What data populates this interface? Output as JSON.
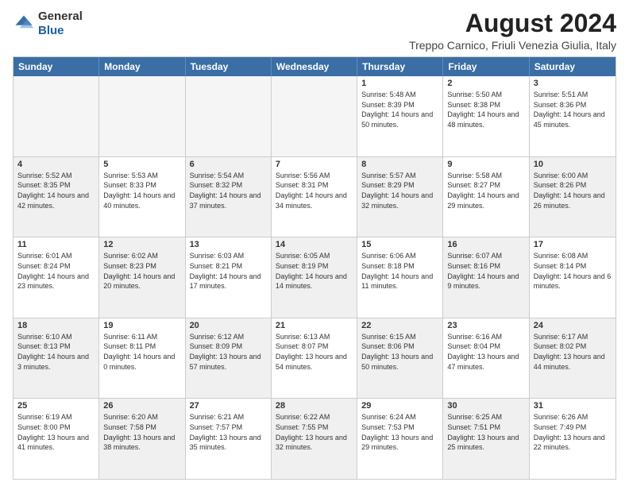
{
  "logo": {
    "general": "General",
    "blue": "Blue"
  },
  "header": {
    "month_year": "August 2024",
    "location": "Treppo Carnico, Friuli Venezia Giulia, Italy"
  },
  "days_of_week": [
    "Sunday",
    "Monday",
    "Tuesday",
    "Wednesday",
    "Thursday",
    "Friday",
    "Saturday"
  ],
  "rows": [
    {
      "cells": [
        {
          "day": "",
          "empty": true
        },
        {
          "day": "",
          "empty": true
        },
        {
          "day": "",
          "empty": true
        },
        {
          "day": "",
          "empty": true
        },
        {
          "day": "1",
          "info": "Sunrise: 5:48 AM\nSunset: 8:39 PM\nDaylight: 14 hours and 50 minutes."
        },
        {
          "day": "2",
          "info": "Sunrise: 5:50 AM\nSunset: 8:38 PM\nDaylight: 14 hours and 48 minutes."
        },
        {
          "day": "3",
          "info": "Sunrise: 5:51 AM\nSunset: 8:36 PM\nDaylight: 14 hours and 45 minutes."
        }
      ]
    },
    {
      "cells": [
        {
          "day": "4",
          "shaded": true,
          "info": "Sunrise: 5:52 AM\nSunset: 8:35 PM\nDaylight: 14 hours and 42 minutes."
        },
        {
          "day": "5",
          "info": "Sunrise: 5:53 AM\nSunset: 8:33 PM\nDaylight: 14 hours and 40 minutes."
        },
        {
          "day": "6",
          "shaded": true,
          "info": "Sunrise: 5:54 AM\nSunset: 8:32 PM\nDaylight: 14 hours and 37 minutes."
        },
        {
          "day": "7",
          "info": "Sunrise: 5:56 AM\nSunset: 8:31 PM\nDaylight: 14 hours and 34 minutes."
        },
        {
          "day": "8",
          "shaded": true,
          "info": "Sunrise: 5:57 AM\nSunset: 8:29 PM\nDaylight: 14 hours and 32 minutes."
        },
        {
          "day": "9",
          "info": "Sunrise: 5:58 AM\nSunset: 8:27 PM\nDaylight: 14 hours and 29 minutes."
        },
        {
          "day": "10",
          "shaded": true,
          "info": "Sunrise: 6:00 AM\nSunset: 8:26 PM\nDaylight: 14 hours and 26 minutes."
        }
      ]
    },
    {
      "cells": [
        {
          "day": "11",
          "info": "Sunrise: 6:01 AM\nSunset: 8:24 PM\nDaylight: 14 hours and 23 minutes."
        },
        {
          "day": "12",
          "shaded": true,
          "info": "Sunrise: 6:02 AM\nSunset: 8:23 PM\nDaylight: 14 hours and 20 minutes."
        },
        {
          "day": "13",
          "info": "Sunrise: 6:03 AM\nSunset: 8:21 PM\nDaylight: 14 hours and 17 minutes."
        },
        {
          "day": "14",
          "shaded": true,
          "info": "Sunrise: 6:05 AM\nSunset: 8:19 PM\nDaylight: 14 hours and 14 minutes."
        },
        {
          "day": "15",
          "info": "Sunrise: 6:06 AM\nSunset: 8:18 PM\nDaylight: 14 hours and 11 minutes."
        },
        {
          "day": "16",
          "shaded": true,
          "info": "Sunrise: 6:07 AM\nSunset: 8:16 PM\nDaylight: 14 hours and 9 minutes."
        },
        {
          "day": "17",
          "info": "Sunrise: 6:08 AM\nSunset: 8:14 PM\nDaylight: 14 hours and 6 minutes."
        }
      ]
    },
    {
      "cells": [
        {
          "day": "18",
          "shaded": true,
          "info": "Sunrise: 6:10 AM\nSunset: 8:13 PM\nDaylight: 14 hours and 3 minutes."
        },
        {
          "day": "19",
          "info": "Sunrise: 6:11 AM\nSunset: 8:11 PM\nDaylight: 14 hours and 0 minutes."
        },
        {
          "day": "20",
          "shaded": true,
          "info": "Sunrise: 6:12 AM\nSunset: 8:09 PM\nDaylight: 13 hours and 57 minutes."
        },
        {
          "day": "21",
          "info": "Sunrise: 6:13 AM\nSunset: 8:07 PM\nDaylight: 13 hours and 54 minutes."
        },
        {
          "day": "22",
          "shaded": true,
          "info": "Sunrise: 6:15 AM\nSunset: 8:06 PM\nDaylight: 13 hours and 50 minutes."
        },
        {
          "day": "23",
          "info": "Sunrise: 6:16 AM\nSunset: 8:04 PM\nDaylight: 13 hours and 47 minutes."
        },
        {
          "day": "24",
          "shaded": true,
          "info": "Sunrise: 6:17 AM\nSunset: 8:02 PM\nDaylight: 13 hours and 44 minutes."
        }
      ]
    },
    {
      "cells": [
        {
          "day": "25",
          "info": "Sunrise: 6:19 AM\nSunset: 8:00 PM\nDaylight: 13 hours and 41 minutes."
        },
        {
          "day": "26",
          "shaded": true,
          "info": "Sunrise: 6:20 AM\nSunset: 7:58 PM\nDaylight: 13 hours and 38 minutes."
        },
        {
          "day": "27",
          "info": "Sunrise: 6:21 AM\nSunset: 7:57 PM\nDaylight: 13 hours and 35 minutes."
        },
        {
          "day": "28",
          "shaded": true,
          "info": "Sunrise: 6:22 AM\nSunset: 7:55 PM\nDaylight: 13 hours and 32 minutes."
        },
        {
          "day": "29",
          "info": "Sunrise: 6:24 AM\nSunset: 7:53 PM\nDaylight: 13 hours and 29 minutes."
        },
        {
          "day": "30",
          "shaded": true,
          "info": "Sunrise: 6:25 AM\nSunset: 7:51 PM\nDaylight: 13 hours and 25 minutes."
        },
        {
          "day": "31",
          "info": "Sunrise: 6:26 AM\nSunset: 7:49 PM\nDaylight: 13 hours and 22 minutes."
        }
      ]
    }
  ]
}
